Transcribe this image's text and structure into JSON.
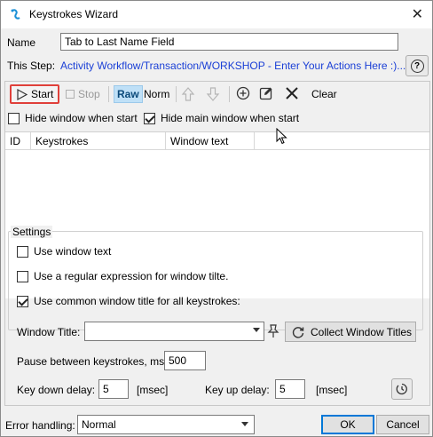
{
  "window": {
    "title": "Keystrokes Wizard"
  },
  "name": {
    "label": "Name",
    "value": "Tab to Last Name Field"
  },
  "step": {
    "label": "This Step:",
    "link": "Activity Workflow/Transaction/WORKSHOP - Enter Your Actions Here :)..."
  },
  "toolbar": {
    "start": "Start",
    "stop": "Stop",
    "raw": "Raw",
    "norm": "Norm",
    "clear": "Clear"
  },
  "options": {
    "hide_window": "Hide window when start",
    "hide_main": "Hide main window when start",
    "hide_window_checked": false,
    "hide_main_checked": true
  },
  "grid": {
    "columns": [
      "ID",
      "Keystrokes",
      "Window text"
    ]
  },
  "settings": {
    "title": "Settings",
    "use_window_text": "Use window text",
    "use_regex": "Use a regular expression for window tilte.",
    "use_common_title": "Use common window title for all keystrokes:",
    "use_window_text_checked": false,
    "use_regex_checked": false,
    "use_common_title_checked": true,
    "window_title_label": "Window Title:",
    "window_title_value": "",
    "collect_button": "Collect Window Titles",
    "pause_label": "Pause between keystrokes, ms:",
    "pause_value": "500",
    "key_down_label": "Key down delay:",
    "key_down_value": "5",
    "key_down_unit": "[msec]",
    "key_up_label": "Key up delay:",
    "key_up_value": "5",
    "key_up_unit": "[msec]"
  },
  "footer": {
    "error_label": "Error handling:",
    "error_value": "Normal",
    "ok": "OK",
    "cancel": "Cancel"
  },
  "colors": {
    "link": "#1a3fd6",
    "highlight": "#e0403a",
    "raw_bg": "#bfe0f7"
  }
}
